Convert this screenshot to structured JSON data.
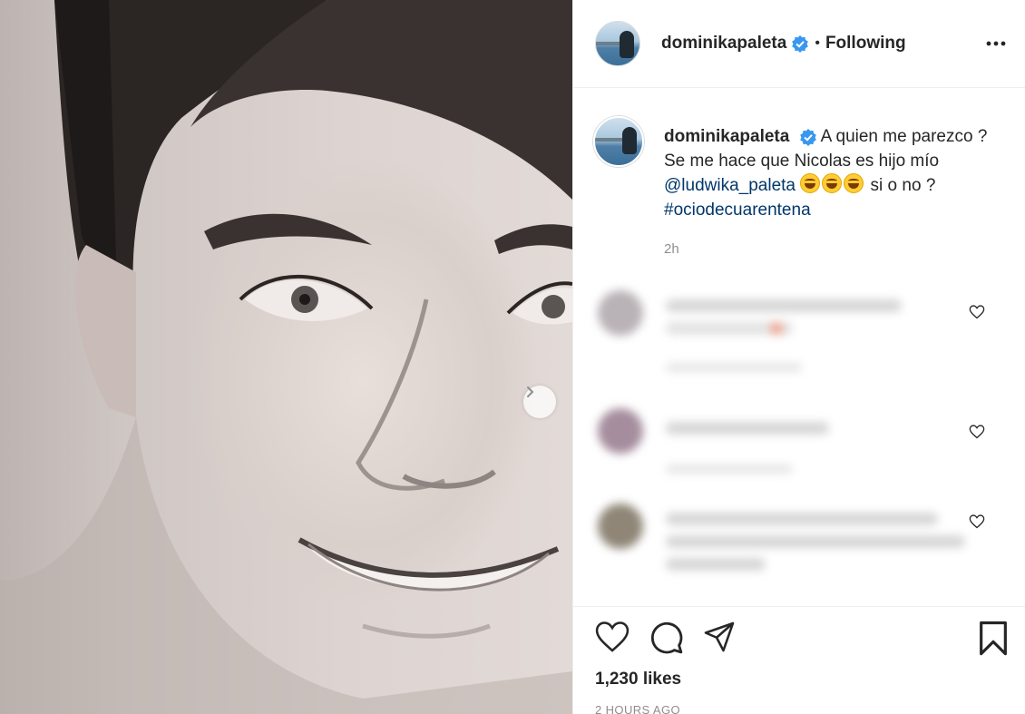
{
  "post": {
    "username": "dominikapaleta",
    "separator": "•",
    "follow_status": "Following",
    "caption_text_1": "A quien me parezco ? Se me hace que Nicolas es hijo mío ",
    "mention": "@ludwika_paleta",
    "caption_text_2": " si o no ? ",
    "hashtag": "#ociodecuarentena",
    "relative_time": "2h",
    "likes": "1,230 likes",
    "posted_ago": "2 HOURS AGO"
  },
  "colors": {
    "verified": "#3897f0",
    "link": "#00376b",
    "muted": "#8e8e8e",
    "border": "#efefef"
  },
  "icons": [
    "verified-badge-icon",
    "more-options-icon",
    "chevron-right-icon",
    "heart-icon",
    "comment-icon",
    "share-icon",
    "bookmark-icon"
  ]
}
